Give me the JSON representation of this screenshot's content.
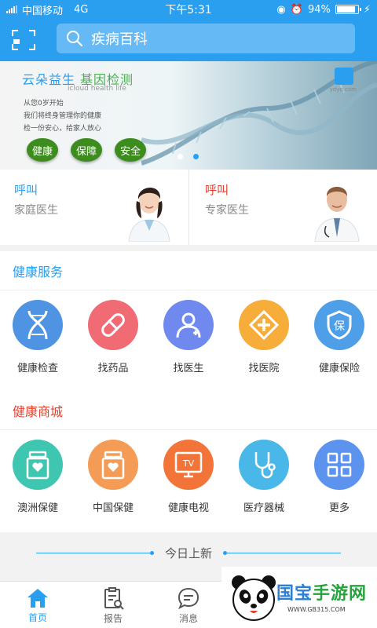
{
  "status_bar": {
    "carrier": "中国移动",
    "network": "4G",
    "time": "下午5:31",
    "battery_percent": "94%",
    "battery_level": 0.94
  },
  "header": {
    "search_placeholder": "疾病百科",
    "accent_color": "#2a9ff0"
  },
  "banner": {
    "title_main": "云朵益生",
    "title_highlight": "基因检测",
    "subtitle": "icloud health life",
    "desc_lines": [
      "从您0岁开始",
      "我们将终身管理你的健康",
      "检一份安心，给家人放心"
    ],
    "badges": [
      "健康",
      "保障",
      "安全"
    ],
    "brand_text": "ydyq.com",
    "slide_count": 2,
    "active_slide": 1
  },
  "doctors": [
    {
      "call": "呼叫",
      "role": "家庭医生",
      "icon": "female-doctor-avatar"
    },
    {
      "call": "呼叫",
      "role": "专家医生",
      "icon": "male-doctor-avatar"
    }
  ],
  "health_services": {
    "title": "健康服务",
    "items": [
      {
        "label": "健康检查",
        "icon": "dna-icon",
        "color": "#4f94e3"
      },
      {
        "label": "找药品",
        "icon": "pill-icon",
        "color": "#f06b74"
      },
      {
        "label": "找医生",
        "icon": "doctor-icon",
        "color": "#6f89ee"
      },
      {
        "label": "找医院",
        "icon": "hospital-cross-icon",
        "color": "#f6ad3a"
      },
      {
        "label": "健康保险",
        "icon": "insurance-shield-icon",
        "color": "#4f9fe8"
      }
    ]
  },
  "health_mall": {
    "title": "健康商城",
    "items": [
      {
        "label": "澳洲保健",
        "icon": "supplement-jar-icon",
        "color": "#3fc6b0"
      },
      {
        "label": "中国保健",
        "icon": "supplement-jar-icon",
        "color": "#f49b55"
      },
      {
        "label": "健康电视",
        "icon": "tv-icon",
        "color": "#f27438"
      },
      {
        "label": "医疗器械",
        "icon": "stethoscope-icon",
        "color": "#49b8e8"
      },
      {
        "label": "更多",
        "icon": "grid-more-icon",
        "color": "#5b93ee"
      }
    ]
  },
  "new_today": "今日上新",
  "tabbar": [
    {
      "label": "首页",
      "icon": "home-icon",
      "active": true
    },
    {
      "label": "报告",
      "icon": "report-icon",
      "active": false
    },
    {
      "label": "消息",
      "icon": "message-icon",
      "active": false
    }
  ],
  "watermark": {
    "brand_a": "国宝",
    "brand_b": "手游网",
    "url": "WWW.GB315.COM"
  }
}
